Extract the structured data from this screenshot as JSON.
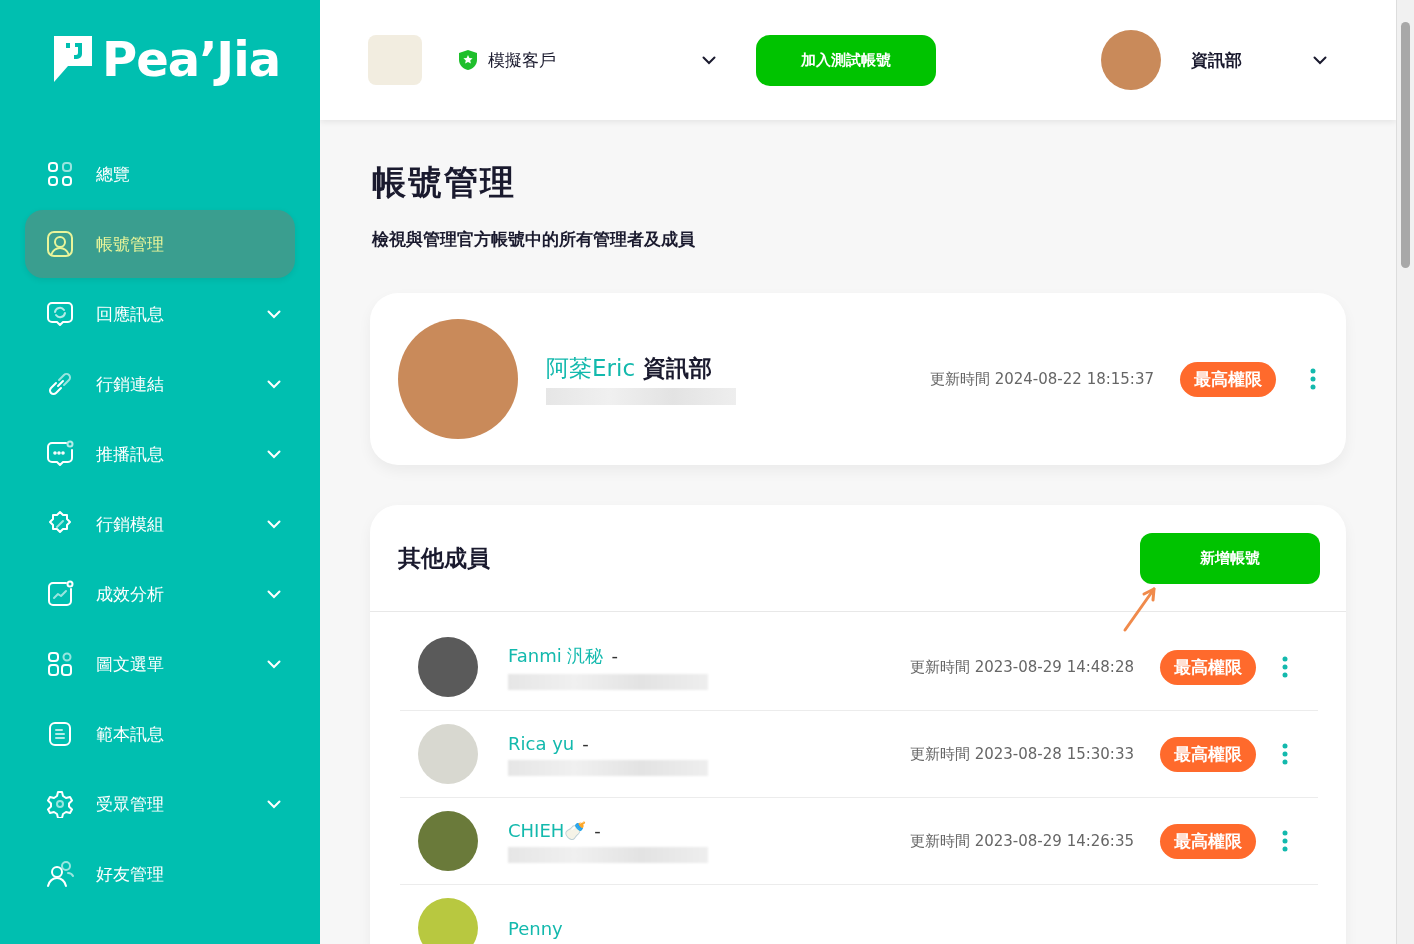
{
  "brand": {
    "logo_text": "Pea’Jia"
  },
  "sidebar": {
    "items": [
      {
        "label": "總覽",
        "kind": "grid",
        "selected": false,
        "expandable": false
      },
      {
        "label": "帳號管理",
        "kind": "user",
        "selected": true,
        "expandable": false
      },
      {
        "label": "回應訊息",
        "kind": "chat-refresh",
        "selected": false,
        "expandable": true
      },
      {
        "label": "行銷連結",
        "kind": "link",
        "selected": false,
        "expandable": true
      },
      {
        "label": "推播訊息",
        "kind": "chat-dots",
        "selected": false,
        "expandable": true
      },
      {
        "label": "行銷模組",
        "kind": "badge",
        "selected": false,
        "expandable": true
      },
      {
        "label": "成效分析",
        "kind": "chart",
        "selected": false,
        "expandable": true
      },
      {
        "label": "圖文選單",
        "kind": "tiles",
        "selected": false,
        "expandable": true
      },
      {
        "label": "範本訊息",
        "kind": "doc",
        "selected": false,
        "expandable": false
      },
      {
        "label": "受眾管理",
        "kind": "gear",
        "selected": false,
        "expandable": true
      },
      {
        "label": "好友管理",
        "kind": "users",
        "selected": false,
        "expandable": false
      }
    ]
  },
  "header": {
    "account": {
      "name": "模擬客戶"
    },
    "join_button": "加入測試帳號",
    "user": {
      "name": "資訊部"
    }
  },
  "page": {
    "title": "帳號管理",
    "subtitle": "檢視與管理官方帳號中的所有管理者及成員"
  },
  "owner": {
    "name": "阿棻Eric",
    "department": "資訊部",
    "updated": "更新時間 2024-08-22 18:15:37",
    "role": "最高權限"
  },
  "members": {
    "title": "其他成員",
    "add_button": "新增帳號",
    "rows": [
      {
        "name": "Fanmi 汎秘",
        "separator": "-",
        "updated": "更新時間 2023-08-29 14:48:28",
        "role": "最高權限"
      },
      {
        "name": "Rica yu",
        "separator": "-",
        "updated": "更新時間 2023-08-28 15:30:33",
        "role": "最高權限"
      },
      {
        "name": "CHIEH🍼",
        "separator": "-",
        "updated": "更新時間 2023-08-29 14:26:35",
        "role": "最高權限"
      },
      {
        "name": "Penny",
        "separator": "",
        "updated": "",
        "role": ""
      }
    ]
  }
}
